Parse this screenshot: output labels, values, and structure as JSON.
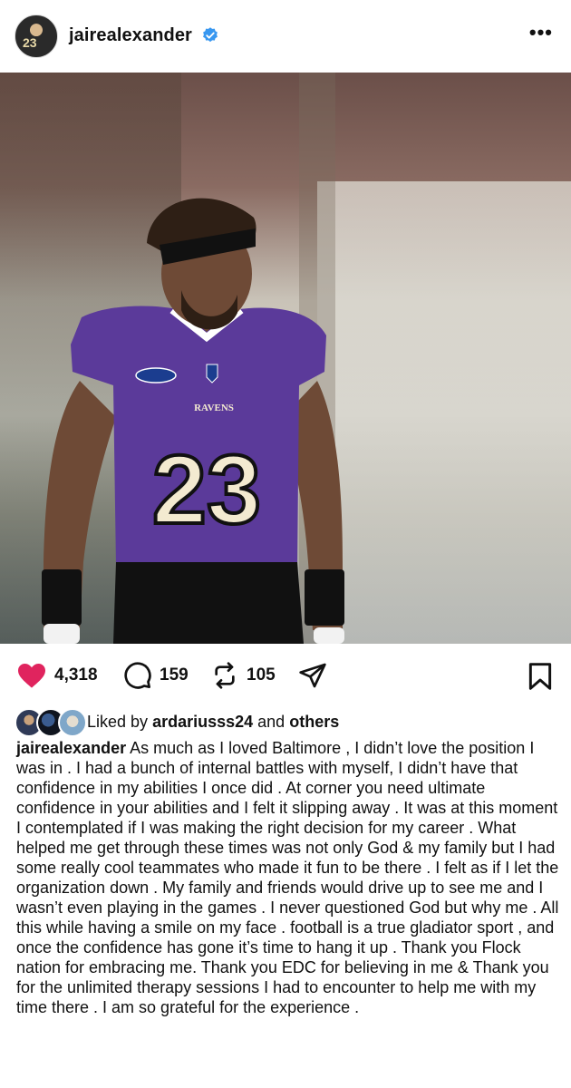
{
  "header": {
    "username": "jairealexander",
    "verified_icon": "verified-badge-icon",
    "more_icon": "more-options-icon",
    "more_label": "•••"
  },
  "photo": {
    "jersey_number": "23",
    "jersey_team": "RAVENS"
  },
  "actions": {
    "like_count": "4,318",
    "comment_count": "159",
    "repost_count": "105",
    "like_color": "#e0245e"
  },
  "liked_by": {
    "prefix": "Liked by",
    "user": "ardariusss24",
    "conjunction": "and",
    "others": "others"
  },
  "caption": {
    "user": "jairealexander",
    "text": "As much as I loved Baltimore , I didn’t love the position I was in . I had a bunch of internal battles with myself, I didn’t have that confidence in my abilities I once did . At corner you need ultimate confidence in your abilities and I felt it slipping away . It was at this moment I contemplated if I was making the right decision for my career . What helped me get through these times was not only God & my family but I had some really cool teammates who made it fun to be there . I felt as if I let the organization down . My family and friends would drive up to see me and I wasn’t even playing in the games . I never questioned God but why me . All this while having a smile on my face .  football is a true gladiator sport , and once the confidence has gone it’s time to hang it up .  Thank you Flock nation for embracing me. Thank you EDC for believing in me & Thank you for the unlimited therapy sessions I had to encounter to help me with my time there . I am so grateful for the experience ."
  }
}
